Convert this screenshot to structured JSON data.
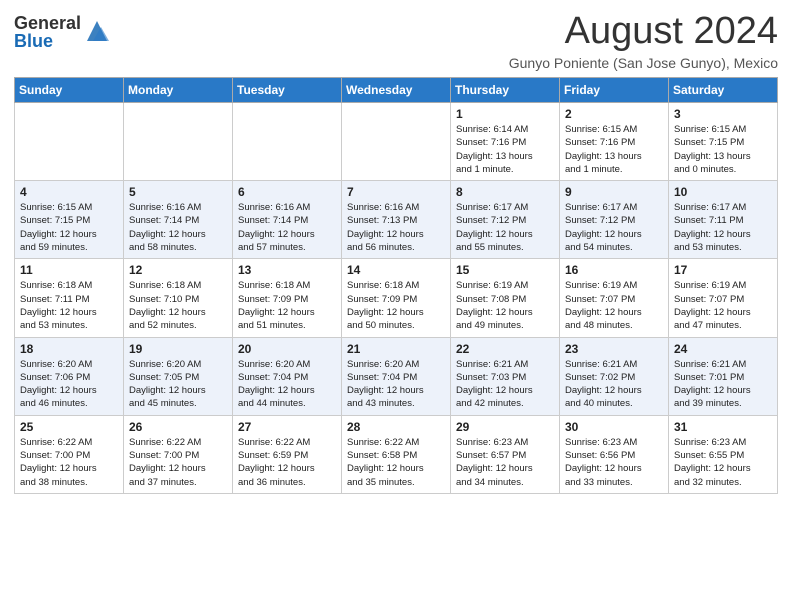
{
  "header": {
    "logo_general": "General",
    "logo_blue": "Blue",
    "month_title": "August 2024",
    "subtitle": "Gunyo Poniente (San Jose Gunyo), Mexico"
  },
  "weekdays": [
    "Sunday",
    "Monday",
    "Tuesday",
    "Wednesday",
    "Thursday",
    "Friday",
    "Saturday"
  ],
  "weeks": [
    [
      {
        "day": "",
        "info": ""
      },
      {
        "day": "",
        "info": ""
      },
      {
        "day": "",
        "info": ""
      },
      {
        "day": "",
        "info": ""
      },
      {
        "day": "1",
        "info": "Sunrise: 6:14 AM\nSunset: 7:16 PM\nDaylight: 13 hours\nand 1 minute."
      },
      {
        "day": "2",
        "info": "Sunrise: 6:15 AM\nSunset: 7:16 PM\nDaylight: 13 hours\nand 1 minute."
      },
      {
        "day": "3",
        "info": "Sunrise: 6:15 AM\nSunset: 7:15 PM\nDaylight: 13 hours\nand 0 minutes."
      }
    ],
    [
      {
        "day": "4",
        "info": "Sunrise: 6:15 AM\nSunset: 7:15 PM\nDaylight: 12 hours\nand 59 minutes."
      },
      {
        "day": "5",
        "info": "Sunrise: 6:16 AM\nSunset: 7:14 PM\nDaylight: 12 hours\nand 58 minutes."
      },
      {
        "day": "6",
        "info": "Sunrise: 6:16 AM\nSunset: 7:14 PM\nDaylight: 12 hours\nand 57 minutes."
      },
      {
        "day": "7",
        "info": "Sunrise: 6:16 AM\nSunset: 7:13 PM\nDaylight: 12 hours\nand 56 minutes."
      },
      {
        "day": "8",
        "info": "Sunrise: 6:17 AM\nSunset: 7:12 PM\nDaylight: 12 hours\nand 55 minutes."
      },
      {
        "day": "9",
        "info": "Sunrise: 6:17 AM\nSunset: 7:12 PM\nDaylight: 12 hours\nand 54 minutes."
      },
      {
        "day": "10",
        "info": "Sunrise: 6:17 AM\nSunset: 7:11 PM\nDaylight: 12 hours\nand 53 minutes."
      }
    ],
    [
      {
        "day": "11",
        "info": "Sunrise: 6:18 AM\nSunset: 7:11 PM\nDaylight: 12 hours\nand 53 minutes."
      },
      {
        "day": "12",
        "info": "Sunrise: 6:18 AM\nSunset: 7:10 PM\nDaylight: 12 hours\nand 52 minutes."
      },
      {
        "day": "13",
        "info": "Sunrise: 6:18 AM\nSunset: 7:09 PM\nDaylight: 12 hours\nand 51 minutes."
      },
      {
        "day": "14",
        "info": "Sunrise: 6:18 AM\nSunset: 7:09 PM\nDaylight: 12 hours\nand 50 minutes."
      },
      {
        "day": "15",
        "info": "Sunrise: 6:19 AM\nSunset: 7:08 PM\nDaylight: 12 hours\nand 49 minutes."
      },
      {
        "day": "16",
        "info": "Sunrise: 6:19 AM\nSunset: 7:07 PM\nDaylight: 12 hours\nand 48 minutes."
      },
      {
        "day": "17",
        "info": "Sunrise: 6:19 AM\nSunset: 7:07 PM\nDaylight: 12 hours\nand 47 minutes."
      }
    ],
    [
      {
        "day": "18",
        "info": "Sunrise: 6:20 AM\nSunset: 7:06 PM\nDaylight: 12 hours\nand 46 minutes."
      },
      {
        "day": "19",
        "info": "Sunrise: 6:20 AM\nSunset: 7:05 PM\nDaylight: 12 hours\nand 45 minutes."
      },
      {
        "day": "20",
        "info": "Sunrise: 6:20 AM\nSunset: 7:04 PM\nDaylight: 12 hours\nand 44 minutes."
      },
      {
        "day": "21",
        "info": "Sunrise: 6:20 AM\nSunset: 7:04 PM\nDaylight: 12 hours\nand 43 minutes."
      },
      {
        "day": "22",
        "info": "Sunrise: 6:21 AM\nSunset: 7:03 PM\nDaylight: 12 hours\nand 42 minutes."
      },
      {
        "day": "23",
        "info": "Sunrise: 6:21 AM\nSunset: 7:02 PM\nDaylight: 12 hours\nand 40 minutes."
      },
      {
        "day": "24",
        "info": "Sunrise: 6:21 AM\nSunset: 7:01 PM\nDaylight: 12 hours\nand 39 minutes."
      }
    ],
    [
      {
        "day": "25",
        "info": "Sunrise: 6:22 AM\nSunset: 7:00 PM\nDaylight: 12 hours\nand 38 minutes."
      },
      {
        "day": "26",
        "info": "Sunrise: 6:22 AM\nSunset: 7:00 PM\nDaylight: 12 hours\nand 37 minutes."
      },
      {
        "day": "27",
        "info": "Sunrise: 6:22 AM\nSunset: 6:59 PM\nDaylight: 12 hours\nand 36 minutes."
      },
      {
        "day": "28",
        "info": "Sunrise: 6:22 AM\nSunset: 6:58 PM\nDaylight: 12 hours\nand 35 minutes."
      },
      {
        "day": "29",
        "info": "Sunrise: 6:23 AM\nSunset: 6:57 PM\nDaylight: 12 hours\nand 34 minutes."
      },
      {
        "day": "30",
        "info": "Sunrise: 6:23 AM\nSunset: 6:56 PM\nDaylight: 12 hours\nand 33 minutes."
      },
      {
        "day": "31",
        "info": "Sunrise: 6:23 AM\nSunset: 6:55 PM\nDaylight: 12 hours\nand 32 minutes."
      }
    ]
  ]
}
